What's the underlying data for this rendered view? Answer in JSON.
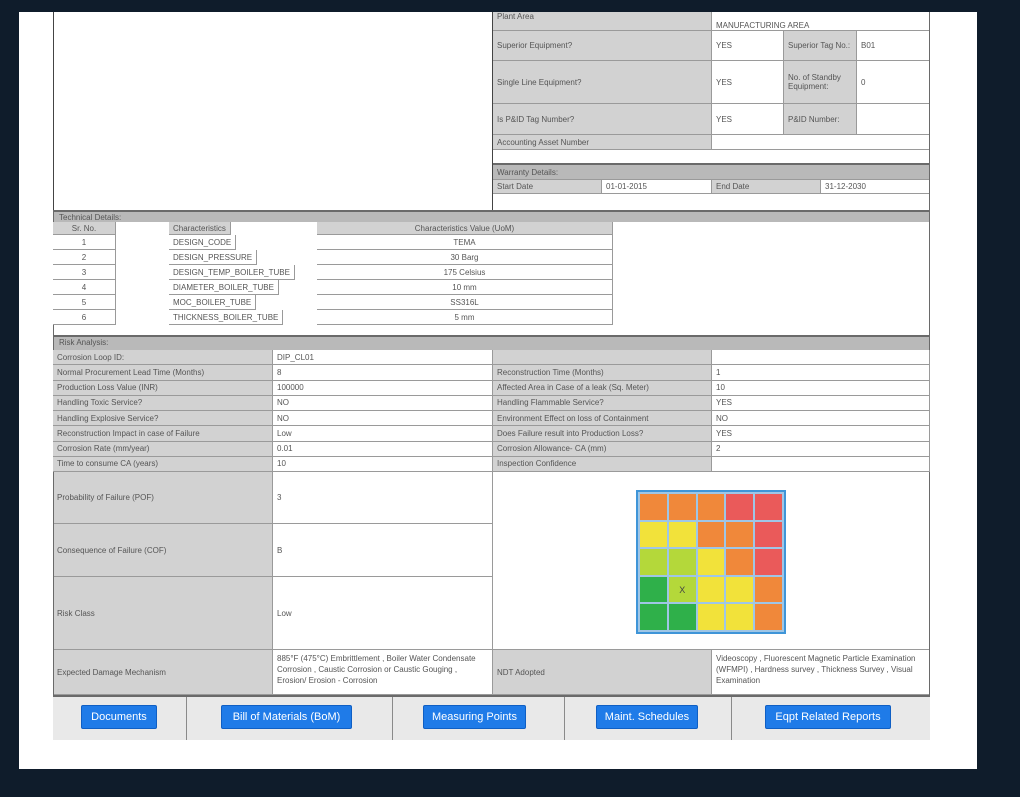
{
  "general": {
    "plant_area_label": "Plant Area",
    "plant_area_value": "MANUFACTURING AREA",
    "superior_equipment_label": "Superior Equipment?",
    "superior_equipment_value": "YES",
    "superior_tag_label": "Superior Tag No.:",
    "superior_tag_value": "B01",
    "single_line_label": "Single Line Equipment?",
    "single_line_value": "YES",
    "standby_label": "No. of Standby Equipment:",
    "standby_value": "0",
    "pid_tag_label": "Is P&ID Tag Number?",
    "pid_tag_value": "YES",
    "pid_number_label": "P&ID Number:",
    "accounting_label": "Accounting Asset Number"
  },
  "warranty": {
    "title": "Warranty Details:",
    "start_label": "Start Date",
    "start_value": "01-01-2015",
    "end_label": "End Date",
    "end_value": "31-12-2030"
  },
  "technical": {
    "title": "Technical Details:",
    "headers": [
      "Sr. No.",
      "Characteristics",
      "Characteristics Value (UoM)"
    ],
    "rows": [
      [
        "1",
        "DESIGN_CODE",
        "TEMA"
      ],
      [
        "2",
        "DESIGN_PRESSURE",
        "30 Barg"
      ],
      [
        "3",
        "DESIGN_TEMP_BOILER_TUBE",
        "175 Celsius"
      ],
      [
        "4",
        "DIAMETER_BOILER_TUBE",
        "10 mm"
      ],
      [
        "5",
        "MOC_BOILER_TUBE",
        "SS316L"
      ],
      [
        "6",
        "THICKNESS_BOILER_TUBE",
        "5 mm"
      ]
    ]
  },
  "risk": {
    "title": "Risk Analysis:",
    "rows": [
      [
        "Corrosion Loop ID:",
        "DIP_CL01",
        "",
        ""
      ],
      [
        "Normal Procurement Lead Time (Months)",
        "8",
        "Reconstruction Time (Months)",
        "1"
      ],
      [
        "Production Loss Value (INR)",
        "100000",
        "Affected Area in Case of a leak (Sq. Meter)",
        "10"
      ],
      [
        "Handling Toxic Service?",
        "NO",
        "Handling Flammable Service?",
        "YES"
      ],
      [
        "Handling Explosive Service?",
        "NO",
        "Environment Effect on loss of Containment",
        "NO"
      ],
      [
        "Reconstruction Impact in case of Failure",
        "Low",
        "Does Failure result into Production Loss?",
        "YES"
      ],
      [
        "Corrosion Rate (mm/year)",
        "0.01",
        "Corrosion Allowance- CA (mm)",
        "2"
      ],
      [
        "Time to consume CA (years)",
        "10",
        "Inspection Confidence",
        ""
      ]
    ],
    "pof_label": "Probability of Failure (POF)",
    "pof_value": "3",
    "cof_label": "Consequence of Failure (COF)",
    "cof_value": "B",
    "risk_class_label": "Risk Class",
    "risk_class_value": "Low",
    "damage_label": "Expected Damage Mechanism",
    "damage_value": "885°F (475°C) Embrittlement , Boiler Water Condensate Corrosion , Caustic Corrosion or Caustic Gouging , Erosion/ Erosion - Corrosion",
    "ndt_label": "NDT Adopted",
    "ndt_value": "Videoscopy , Fluorescent Magnetic Particle Examination (WFMPI) , Hardness survey , Thickness Survey , Visual Examination",
    "matrix_marker": "X",
    "matrix_colors": [
      [
        "#f0883a",
        "#f0883a",
        "#f0883a",
        "#ea5a5a",
        "#ea5a5a"
      ],
      [
        "#f2e23a",
        "#f2e23a",
        "#f0883a",
        "#f0883a",
        "#ea5a5a"
      ],
      [
        "#b4d83a",
        "#b4d83a",
        "#f2e23a",
        "#f0883a",
        "#ea5a5a"
      ],
      [
        "#2fb04a",
        "#b4d83a",
        "#f2e23a",
        "#f2e23a",
        "#f0883a"
      ],
      [
        "#2fb04a",
        "#2fb04a",
        "#f2e23a",
        "#f2e23a",
        "#f0883a"
      ]
    ]
  },
  "buttons": {
    "documents": "Documents",
    "bom": "Bill of Materials (BoM)",
    "measuring": "Measuring Points",
    "maint": "Maint. Schedules",
    "reports": "Eqpt Related Reports"
  }
}
